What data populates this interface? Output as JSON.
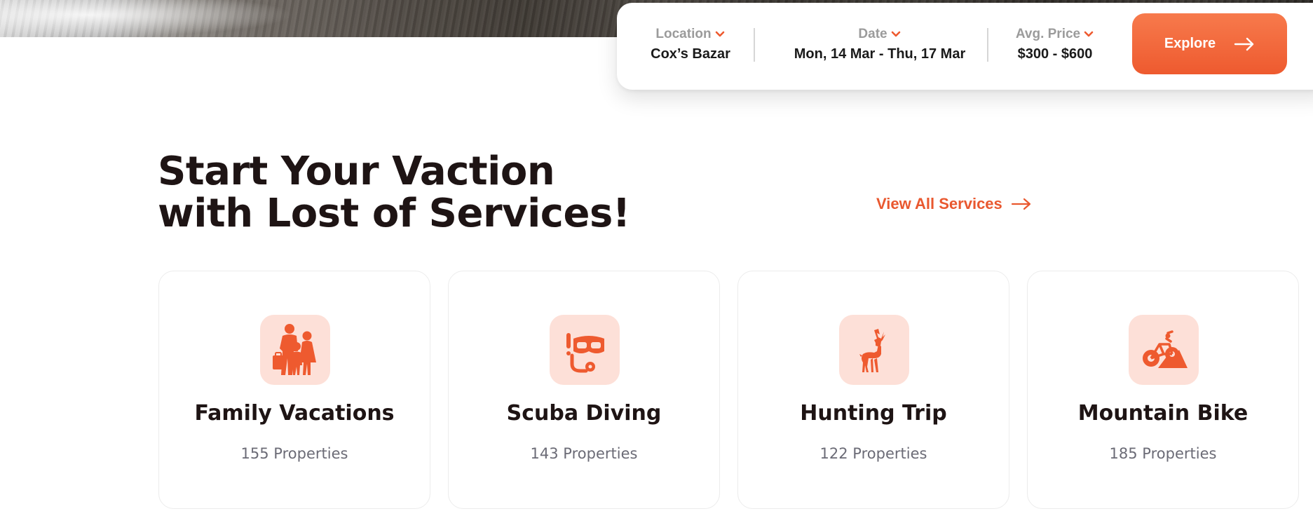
{
  "search": {
    "location_label": "Location",
    "location_value": "Cox’s Bazar",
    "date_label": "Date",
    "date_value": "Mon, 14 Mar - Thu, 17 Mar",
    "price_label": "Avg. Price",
    "price_value": "$300 - $600",
    "explore_label": "Explore"
  },
  "services": {
    "headline_line1": "Start Your Vaction",
    "headline_line2": "with Lost of Services!",
    "view_all_label": "View All Services",
    "cards": [
      {
        "title": "Family Vacations",
        "count": "155 Properties",
        "icon": "family-icon"
      },
      {
        "title": "Scuba Diving",
        "count": "143 Properties",
        "icon": "scuba-icon"
      },
      {
        "title": "Hunting Trip",
        "count": "122 Properties",
        "icon": "deer-icon"
      },
      {
        "title": "Mountain Bike",
        "count": "185 Properties",
        "icon": "mountain-bike-icon"
      }
    ]
  },
  "colors": {
    "accent": "#ee5a2f",
    "icon_bg": "#fde0d8",
    "heading": "#1e1414",
    "muted": "#6b6b76"
  }
}
